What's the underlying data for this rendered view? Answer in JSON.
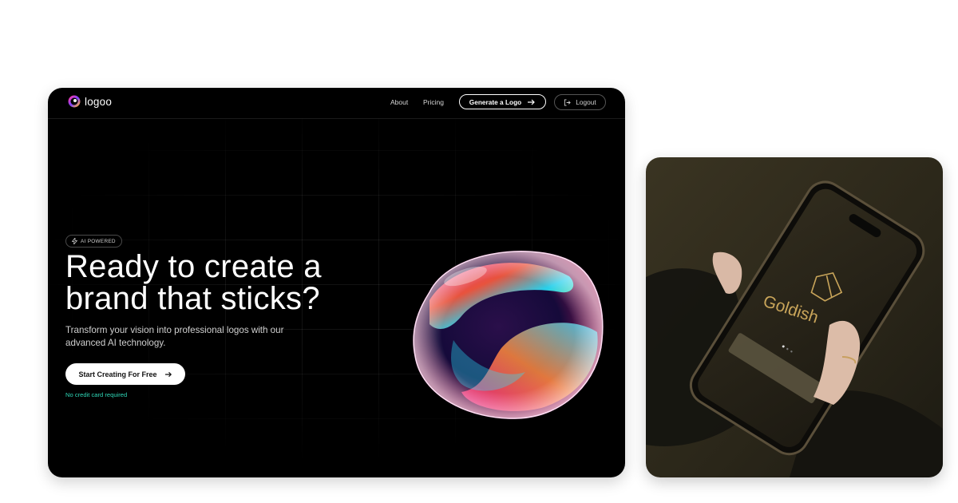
{
  "nav": {
    "brand": "logoo",
    "links": [
      "About",
      "Pricing"
    ],
    "generate_label": "Generate a Logo",
    "logout_label": "Logout"
  },
  "hero": {
    "badge": "AI POWERED",
    "title_line1": "Ready to create a",
    "title_line2": "brand that sticks?",
    "subtitle_line1": "Transform your vision into professional logos with our",
    "subtitle_line2": "advanced AI technology.",
    "cta_label": "Start Creating For Free",
    "note": "No credit card required"
  },
  "photo": {
    "brand_on_phone": "Goldish"
  },
  "colors": {
    "background": "#000000",
    "accent_note": "#2ed8b8",
    "gold": "#c9a55a"
  }
}
